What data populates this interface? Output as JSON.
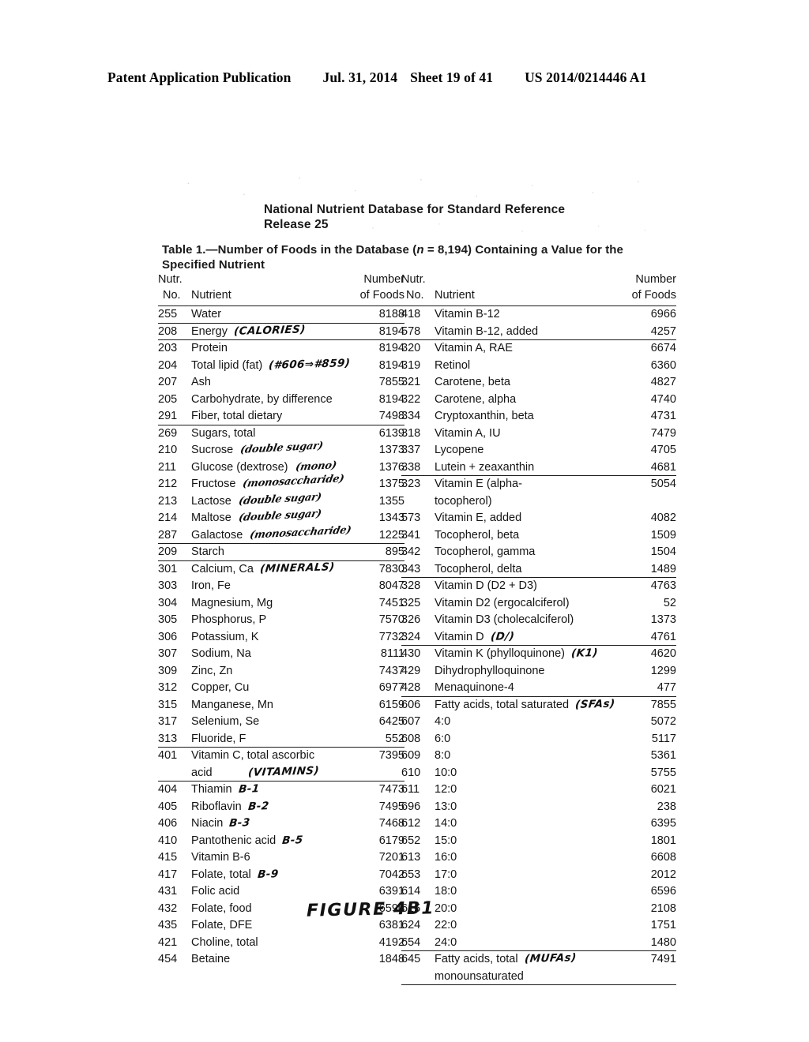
{
  "patent_header": {
    "publication": "Patent Application Publication",
    "date": "Jul. 31, 2014",
    "sheet": "Sheet 19 of 41",
    "patent_number": "US 2014/0214446 A1"
  },
  "document": {
    "title_line1": "National Nutrient Database for Standard Reference",
    "title_line2": "Release 25",
    "caption_prefix": "Table 1.—Number of Foods in the Database (",
    "caption_italic": "n",
    "caption_mid": " = 8,194) Containing a Value for the",
    "caption_line2": "Specified Nutrient",
    "figure_label": "FIGURE 4B1"
  },
  "columns": {
    "header": {
      "nutr": "Nutr.",
      "no": "No.",
      "nutrient": "Nutrient",
      "number": "Number",
      "of_foods": "of Foods"
    },
    "left_rows": [
      {
        "no": "255",
        "name": "Water",
        "value": "8188",
        "rule_after": true
      },
      {
        "no": "208",
        "name": "Energy",
        "hand": "(CALORIES)",
        "hand_style": "caps",
        "value": "8194",
        "rule_after": true
      },
      {
        "no": "203",
        "name": "Protein",
        "value": "8194"
      },
      {
        "no": "204",
        "name": "Total lipid (fat)",
        "hand": "(#606⇒#859)",
        "hand_style": "caps",
        "value": "8194"
      },
      {
        "no": "207",
        "name": "Ash",
        "value": "7855"
      },
      {
        "no": "205",
        "name": "Carbohydrate, by difference",
        "value": "8194"
      },
      {
        "no": "291",
        "name": "Fiber, total dietary",
        "value": "7498",
        "rule_after": true
      },
      {
        "no": "269",
        "name": "Sugars, total",
        "value": "6139"
      },
      {
        "no": "210",
        "name": "Sucrose",
        "hand": "(double sugar)",
        "hand_style": "script",
        "value": "1373"
      },
      {
        "no": "211",
        "name": "Glucose (dextrose)",
        "hand": "(mono)",
        "hand_style": "script",
        "value": "1376"
      },
      {
        "no": "212",
        "name": "Fructose",
        "hand": "(monosaccharide)",
        "hand_style": "script",
        "value": "1375"
      },
      {
        "no": "213",
        "name": "Lactose",
        "hand": "(double sugar)",
        "hand_style": "script",
        "value": "1355"
      },
      {
        "no": "214",
        "name": "Maltose",
        "hand": "(double sugar)",
        "hand_style": "script",
        "value": "1343"
      },
      {
        "no": "287",
        "name": "Galactose",
        "hand": "(monosaccharide)",
        "hand_style": "script",
        "value": "1225",
        "rule_after": true
      },
      {
        "no": "209",
        "name": "Starch",
        "value": "895",
        "rule_after": true
      },
      {
        "no": "301",
        "name": "Calcium, Ca",
        "hand": "(MINERALS)",
        "hand_style": "caps",
        "value": "7830"
      },
      {
        "no": "303",
        "name": "Iron, Fe",
        "value": "8047"
      },
      {
        "no": "304",
        "name": "Magnesium, Mg",
        "value": "7451"
      },
      {
        "no": "305",
        "name": "Phosphorus, P",
        "value": "7570"
      },
      {
        "no": "306",
        "name": "Potassium, K",
        "value": "7732"
      },
      {
        "no": "307",
        "name": "Sodium, Na",
        "value": "8111"
      },
      {
        "no": "309",
        "name": "Zinc, Zn",
        "value": "7437"
      },
      {
        "no": "312",
        "name": "Copper, Cu",
        "value": "6977"
      },
      {
        "no": "315",
        "name": "Manganese, Mn",
        "value": "6159"
      },
      {
        "no": "317",
        "name": "Selenium, Se",
        "value": "6425"
      },
      {
        "no": "313",
        "name": "Fluoride, F",
        "value": "552",
        "rule_after": true
      },
      {
        "no": "401",
        "name": "Vitamin C, total ascorbic",
        "name2": "acid",
        "hand": "(VITAMINS)",
        "hand_style": "caps",
        "hand_on_line2": true,
        "value": "7395",
        "tall": true,
        "rule_after": true
      },
      {
        "no": "404",
        "name": "Thiamin",
        "hand": "B-1",
        "hand_style": "caps",
        "value": "7473"
      },
      {
        "no": "405",
        "name": "Riboflavin",
        "hand": "B-2",
        "hand_style": "caps",
        "value": "7495"
      },
      {
        "no": "406",
        "name": "Niacin",
        "hand": "B-3",
        "hand_style": "caps",
        "value": "7468"
      },
      {
        "no": "410",
        "name": "Pantothenic acid",
        "hand": "B-5",
        "hand_style": "caps",
        "value": "6179"
      },
      {
        "no": "415",
        "name": "Vitamin B-6",
        "value": "7201"
      },
      {
        "no": "417",
        "name": "Folate, total",
        "hand": "B-9",
        "hand_style": "caps",
        "value": "7042"
      },
      {
        "no": "431",
        "name": "Folic acid",
        "value": "6391"
      },
      {
        "no": "432",
        "name": "Folate, food",
        "value": "6590"
      },
      {
        "no": "435",
        "name": "Folate, DFE",
        "value": "6381"
      },
      {
        "no": "421",
        "name": "Choline, total",
        "value": "4192"
      },
      {
        "no": "454",
        "name": "Betaine",
        "value": "1848"
      }
    ],
    "right_rows": [
      {
        "no": "418",
        "name": "Vitamin B-12",
        "value": "6966"
      },
      {
        "no": "578",
        "name": "Vitamin B-12, added",
        "value": "4257",
        "rule_after": true
      },
      {
        "no": "320",
        "name": "Vitamin A, RAE",
        "value": "6674"
      },
      {
        "no": "319",
        "name": "Retinol",
        "value": "6360"
      },
      {
        "no": "321",
        "name": "Carotene, beta",
        "value": "4827"
      },
      {
        "no": "322",
        "name": "Carotene, alpha",
        "value": "4740"
      },
      {
        "no": "334",
        "name": "Cryptoxanthin, beta",
        "value": "4731"
      },
      {
        "no": "318",
        "name": "Vitamin A, IU",
        "value": "7479"
      },
      {
        "no": "337",
        "name": "Lycopene",
        "value": "4705"
      },
      {
        "no": "338",
        "name": "Lutein + zeaxanthin",
        "value": "4681",
        "rule_after": true
      },
      {
        "no": "323",
        "name": "Vitamin E (alpha-",
        "name2": "tocopherol)",
        "value": "5054",
        "tall": true
      },
      {
        "no": "573",
        "name": "Vitamin E, added",
        "value": "4082"
      },
      {
        "no": "341",
        "name": "Tocopherol, beta",
        "value": "1509"
      },
      {
        "no": "342",
        "name": "Tocopherol, gamma",
        "value": "1504"
      },
      {
        "no": "343",
        "name": "Tocopherol, delta",
        "value": "1489",
        "rule_after": true
      },
      {
        "no": "328",
        "name": "Vitamin D (D2 + D3)",
        "value": "4763"
      },
      {
        "no": "325",
        "name": "Vitamin D2 (ergocalciferol)",
        "value": "52"
      },
      {
        "no": "326",
        "name": "Vitamin D3 (cholecalciferol)",
        "value": "1373"
      },
      {
        "no": "324",
        "name": "Vitamin D",
        "hand": "(D/)",
        "hand_style": "caps",
        "value": "4761",
        "rule_after": true
      },
      {
        "no": "430",
        "name": "Vitamin K (phylloquinone)",
        "hand": "(K1)",
        "hand_style": "caps",
        "value": "4620"
      },
      {
        "no": "429",
        "name": "Dihydrophylloquinone",
        "value": "1299"
      },
      {
        "no": "428",
        "name": "Menaquinone-4",
        "value": "477",
        "rule_after": true
      },
      {
        "no": "606",
        "name": "Fatty acids, total saturated",
        "hand": "(SFAs)",
        "hand_style": "caps",
        "value": "7855"
      },
      {
        "no": "607",
        "name": "4:0",
        "value": "5072"
      },
      {
        "no": "608",
        "name": "6:0",
        "value": "5117"
      },
      {
        "no": "609",
        "name": "8:0",
        "value": "5361"
      },
      {
        "no": "610",
        "name": "10:0",
        "value": "5755"
      },
      {
        "no": "611",
        "name": "12:0",
        "value": "6021"
      },
      {
        "no": "696",
        "name": "13:0",
        "value": "238"
      },
      {
        "no": "612",
        "name": "14:0",
        "value": "6395"
      },
      {
        "no": "652",
        "name": "15:0",
        "value": "1801"
      },
      {
        "no": "613",
        "name": "16:0",
        "value": "6608"
      },
      {
        "no": "653",
        "name": "17:0",
        "value": "2012"
      },
      {
        "no": "614",
        "name": "18:0",
        "value": "6596"
      },
      {
        "no": "615",
        "name": "20:0",
        "value": "2108"
      },
      {
        "no": "624",
        "name": "22:0",
        "value": "1751"
      },
      {
        "no": "654",
        "name": "24:0",
        "value": "1480",
        "rule_after": true
      },
      {
        "no": "645",
        "name": "Fatty acids, total",
        "name2": "monounsaturated",
        "hand": "(MUFAs)",
        "hand_style": "caps",
        "value": "7491",
        "tall": true,
        "rule_after": true
      }
    ]
  }
}
